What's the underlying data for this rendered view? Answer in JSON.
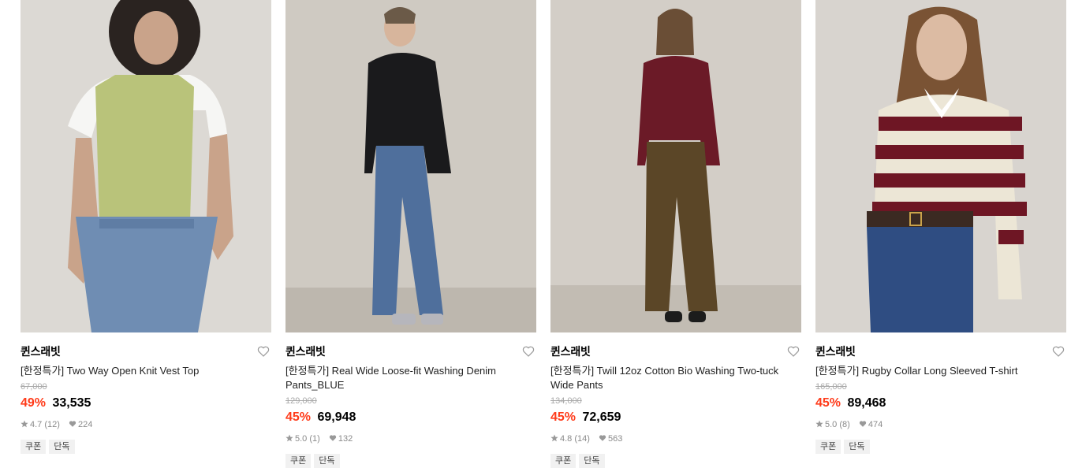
{
  "colors": {
    "discount": "#ff3b1a",
    "original_price": "#aaaaaa",
    "meta": "#8a8a8a",
    "tag_bg": "#f1f1f1"
  },
  "icons": {
    "like": "heart-outline-icon",
    "rating": "star-icon",
    "likes": "heart-filled-icon"
  },
  "products": [
    {
      "brand": "퀸스래빗",
      "title": "[한정특가] Two Way Open Knit Vest Top",
      "original_price": "67,000",
      "discount": "49%",
      "price": "33,535",
      "rating": "4.7",
      "reviews": "(12)",
      "likes": "224",
      "tags": [
        "쿠폰",
        "단독"
      ]
    },
    {
      "brand": "퀸스래빗",
      "title": "[한정특가] Real Wide Loose-fit Washing Denim Pants_BLUE",
      "original_price": "129,000",
      "discount": "45%",
      "price": "69,948",
      "rating": "5.0",
      "reviews": "(1)",
      "likes": "132",
      "tags": [
        "쿠폰",
        "단독"
      ]
    },
    {
      "brand": "퀸스래빗",
      "title": "[한정특가] Twill 12oz Cotton Bio Washing Two-tuck Wide Pants",
      "original_price": "134,000",
      "discount": "45%",
      "price": "72,659",
      "rating": "4.8",
      "reviews": "(14)",
      "likes": "563",
      "tags": [
        "쿠폰",
        "단독"
      ]
    },
    {
      "brand": "퀸스래빗",
      "title": "[한정특가] Rugby Collar Long Sleeved T-shirt",
      "original_price": "165,000",
      "discount": "45%",
      "price": "89,468",
      "rating": "5.0",
      "reviews": "(8)",
      "likes": "474",
      "tags": [
        "쿠폰",
        "단독"
      ]
    }
  ]
}
